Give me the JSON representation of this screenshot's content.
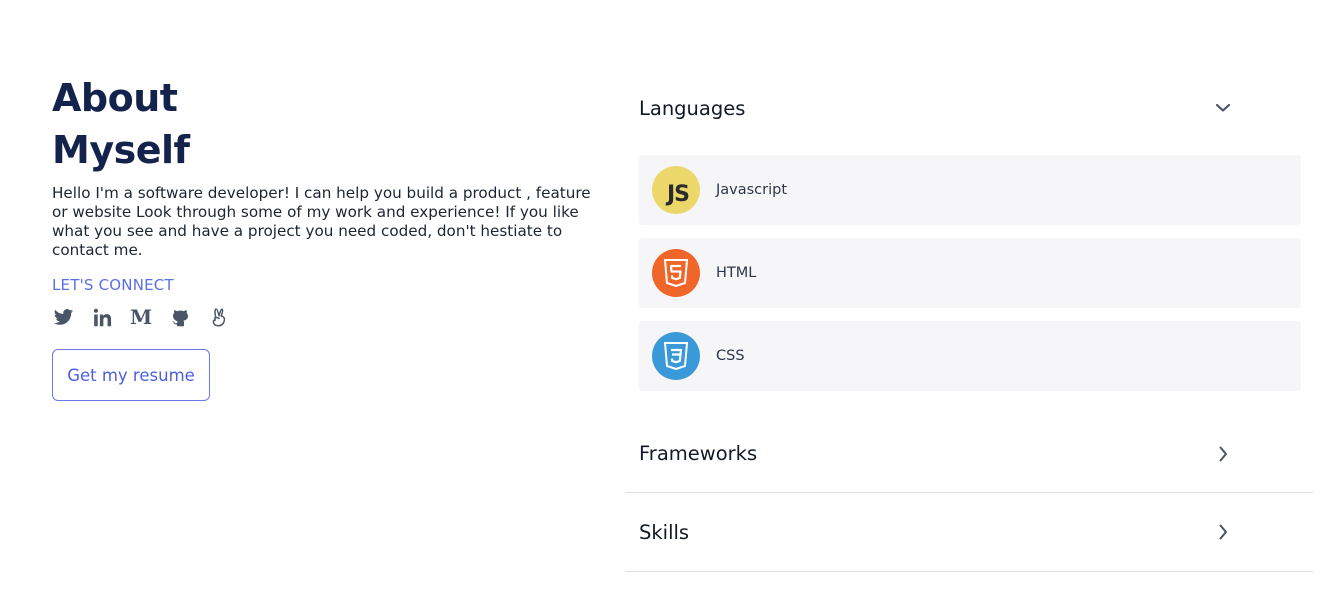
{
  "about": {
    "title_line1": "About",
    "title_line2": "Myself",
    "bio": "Hello I'm a software developer! I can help you build a product , feature or website Look through some of my work and experience! If you like what you see and have a project you need coded, don't hestiate to contact me.",
    "connect_label": "LET'S CONNECT",
    "socials": [
      "twitter-icon",
      "linkedin-icon",
      "medium-icon",
      "github-icon",
      "angellist-icon"
    ],
    "medium_glyph": "M",
    "resume_label": "Get my resume"
  },
  "accordion": {
    "languages": {
      "title": "Languages",
      "state": "expanded",
      "items": [
        {
          "label": "Javascript",
          "logo_text": "JS",
          "icon": "javascript-icon",
          "color": "#ecd86a"
        },
        {
          "label": "HTML",
          "icon": "html5-icon",
          "color": "#f06529"
        },
        {
          "label": "CSS",
          "icon": "css3-icon",
          "color": "#3a99d8"
        }
      ]
    },
    "frameworks": {
      "title": "Frameworks",
      "state": "collapsed"
    },
    "skills": {
      "title": "Skills",
      "state": "collapsed"
    }
  },
  "colors": {
    "heading": "#13234b",
    "accent": "#5a6fe4",
    "item_bg": "#f6f6f8"
  }
}
